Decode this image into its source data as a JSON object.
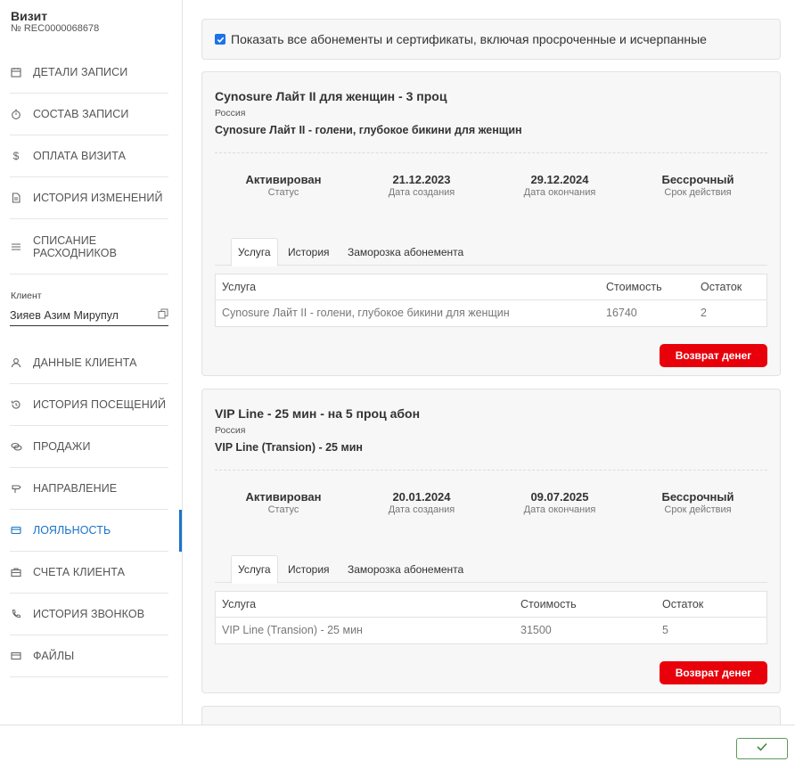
{
  "visit": {
    "title": "Визит",
    "number": "№ REC0000068678"
  },
  "nav_top": [
    {
      "label": "ДЕТАЛИ ЗАПИСИ",
      "icon": "calendar-icon"
    },
    {
      "label": "СОСТАВ ЗАПИСИ",
      "icon": "stopwatch-icon"
    },
    {
      "label": "ОПЛАТА ВИЗИТА",
      "icon": "dollar-icon"
    },
    {
      "label": "ИСТОРИЯ ИЗМЕНЕНИЙ",
      "icon": "document-icon"
    },
    {
      "label": "СПИСАНИЕ РАСХОДНИКОВ",
      "icon": "list-icon"
    }
  ],
  "client": {
    "label": "Клиент",
    "name": "Зияев Азим Мирупул"
  },
  "nav_bottom": [
    {
      "label": "ДАННЫЕ КЛИЕНТА",
      "icon": "user-icon"
    },
    {
      "label": "ИСТОРИЯ ПОСЕЩЕНИЙ",
      "icon": "history-icon"
    },
    {
      "label": "ПРОДАЖИ",
      "icon": "cash-icon"
    },
    {
      "label": "НАПРАВЛЕНИЕ",
      "icon": "signpost-icon"
    },
    {
      "label": "ЛОЯЛЬНОСТЬ",
      "icon": "card-icon",
      "active": true
    },
    {
      "label": "СЧЕТА КЛИЕНТА",
      "icon": "briefcase-icon"
    },
    {
      "label": "ИСТОРИЯ ЗВОНКОВ",
      "icon": "phone-icon"
    },
    {
      "label": "ФАЙЛЫ",
      "icon": "folder-icon"
    }
  ],
  "filter": {
    "checked": true,
    "label": "Показать все абонементы и сертификаты, включая просроченные и исчерпанные"
  },
  "cards": [
    {
      "title": "Cynosure Лайт II для женщин - 3 проц",
      "country": "Россия",
      "subtitle": "Cynosure Лайт II - голени, глубокое бикини для женщин",
      "stats": [
        {
          "value": "Активирован",
          "label": "Статус"
        },
        {
          "value": "21.12.2023",
          "label": "Дата создания"
        },
        {
          "value": "29.12.2024",
          "label": "Дата окончания"
        },
        {
          "value": "Бессрочный",
          "label": "Срок действия"
        }
      ],
      "tabs": [
        "Услуга",
        "История",
        "Заморозка абонемента"
      ],
      "table": {
        "headers": [
          "Услуга",
          "Стоимость",
          "Остаток"
        ],
        "rows": [
          [
            "Cynosure Лайт II - голени, глубокое бикини для женщин",
            "16740",
            "2"
          ]
        ]
      },
      "refund_label": "Возврат денег"
    },
    {
      "title": "VIP Line - 25 мин - на 5 проц абон",
      "country": "Россия",
      "subtitle": "VIP Line (Transion) - 25 мин",
      "stats": [
        {
          "value": "Активирован",
          "label": "Статус"
        },
        {
          "value": "20.01.2024",
          "label": "Дата создания"
        },
        {
          "value": "09.07.2025",
          "label": "Дата окончания"
        },
        {
          "value": "Бессрочный",
          "label": "Срок действия"
        }
      ],
      "tabs": [
        "Услуга",
        "История",
        "Заморозка абонемента"
      ],
      "table": {
        "headers": [
          "Услуга",
          "Стоимость",
          "Остаток"
        ],
        "rows": [
          [
            "VIP Line (Transion) - 25 мин",
            "31500",
            "5"
          ]
        ]
      },
      "refund_label": "Возврат денег"
    }
  ],
  "colors": {
    "accent": "#1a73c8",
    "refund": "#e8000b",
    "ok_border": "#5a9a5a"
  }
}
